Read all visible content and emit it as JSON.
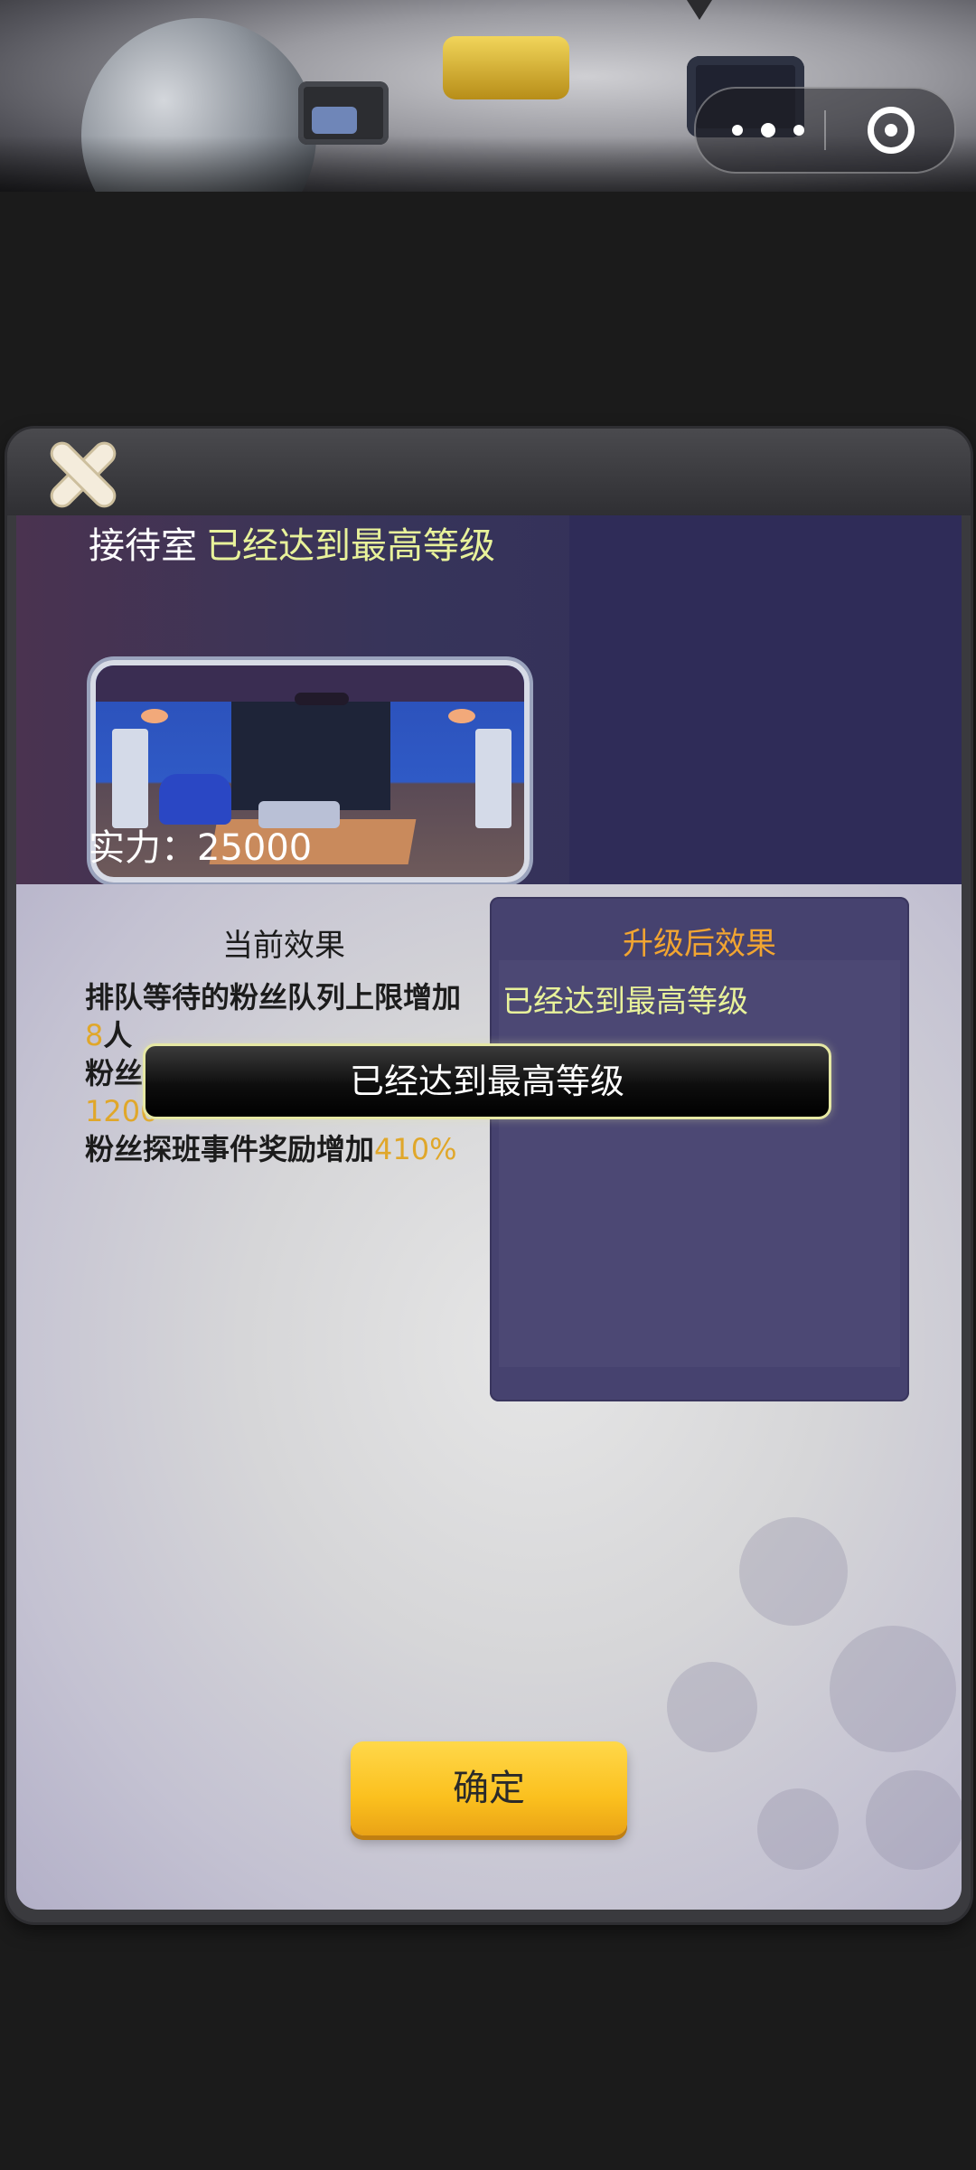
{
  "capsule": {
    "more_icon": "more-dots-icon",
    "close_icon": "target-icon"
  },
  "dialog": {
    "close_icon": "close-icon",
    "building_name": "接待室",
    "max_level_text": "已经达到最高等级",
    "power_label": "实力：25000",
    "current_effect_title": "当前效果",
    "effects": [
      {
        "text_before": "排队等待的粉丝队列上限增加",
        "value": "8",
        "text_after": "人"
      },
      {
        "text_before": "粉丝",
        "value": "1200",
        "text_after": ""
      },
      {
        "text_before": "粉丝探班事件奖励增加",
        "value": "410",
        "text_after": "%"
      }
    ],
    "after_effect_title": "升级后效果",
    "after_effect_text": "已经达到最高等级",
    "confirm_label": "确定"
  },
  "toast": {
    "text": "已经达到最高等级"
  },
  "colors": {
    "accent_yellow": "#e8f29a",
    "accent_orange": "#f2a531",
    "button_yellow": "#fbc01e"
  }
}
